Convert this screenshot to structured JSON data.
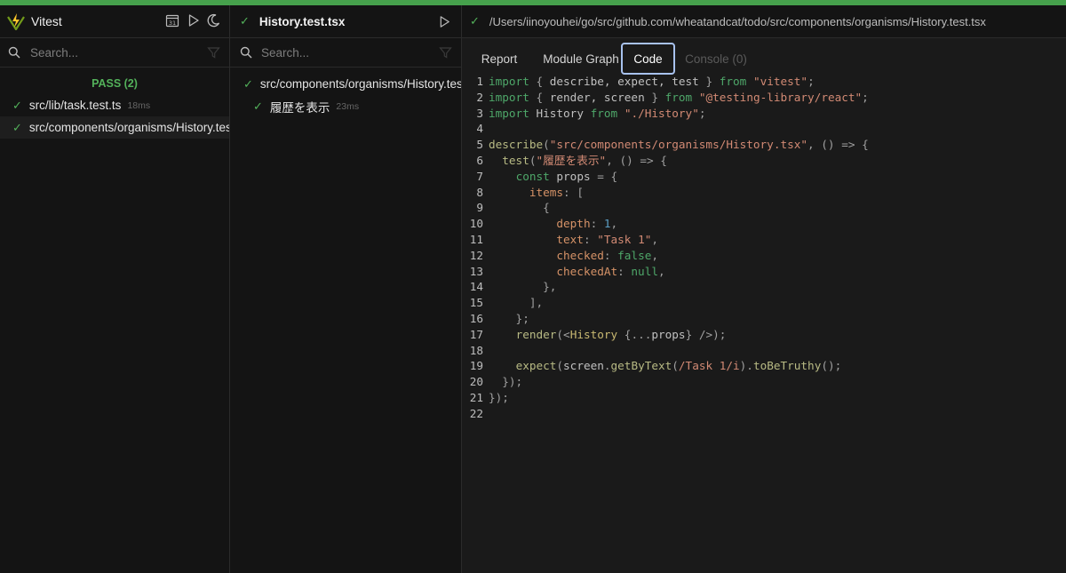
{
  "app": {
    "title": "Vitest"
  },
  "left": {
    "search_placeholder": "Search...",
    "pass_label": "PASS (2)",
    "files": [
      {
        "name": "src/lib/task.test.ts",
        "duration": "18ms"
      },
      {
        "name": "src/components/organisms/History.test.tsx",
        "duration": ""
      }
    ]
  },
  "middle": {
    "title": "History.test.tsx",
    "search_placeholder": "Search...",
    "suite": "src/components/organisms/History.test.tsx",
    "tests": [
      {
        "name": "履歴を表示",
        "duration": "23ms"
      }
    ]
  },
  "right": {
    "path": "/Users/iinoyouhei/go/src/github.com/wheatandcat/todo/src/components/organisms/History.test.tsx",
    "tabs": [
      {
        "label": "Report",
        "state": "normal"
      },
      {
        "label": "Module Graph",
        "state": "normal"
      },
      {
        "label": "Code",
        "state": "active"
      },
      {
        "label": "Console (0)",
        "state": "disabled"
      }
    ]
  },
  "code": {
    "language": "tsx",
    "lines": [
      [
        [
          "kw",
          "import"
        ],
        [
          "punc",
          " { "
        ],
        [
          "id",
          "describe, expect, test"
        ],
        [
          "punc",
          " } "
        ],
        [
          "kw",
          "from"
        ],
        [
          "punc",
          " "
        ],
        [
          "str",
          "\"vitest\""
        ],
        [
          "punc",
          ";"
        ]
      ],
      [
        [
          "kw",
          "import"
        ],
        [
          "punc",
          " { "
        ],
        [
          "id",
          "render, screen"
        ],
        [
          "punc",
          " } "
        ],
        [
          "kw",
          "from"
        ],
        [
          "punc",
          " "
        ],
        [
          "str",
          "\"@testing-library/react\""
        ],
        [
          "punc",
          ";"
        ]
      ],
      [
        [
          "kw",
          "import"
        ],
        [
          "punc",
          " "
        ],
        [
          "id",
          "History"
        ],
        [
          "punc",
          " "
        ],
        [
          "kw",
          "from"
        ],
        [
          "punc",
          " "
        ],
        [
          "str",
          "\"./History\""
        ],
        [
          "punc",
          ";"
        ]
      ],
      [],
      [
        [
          "fn",
          "describe"
        ],
        [
          "punc",
          "("
        ],
        [
          "str",
          "\"src/components/organisms/History.tsx\""
        ],
        [
          "punc",
          ", () => {"
        ]
      ],
      [
        [
          "punc",
          "  "
        ],
        [
          "fn",
          "test"
        ],
        [
          "punc",
          "("
        ],
        [
          "str",
          "\"履歴を表示\""
        ],
        [
          "punc",
          ", () => {"
        ]
      ],
      [
        [
          "punc",
          "    "
        ],
        [
          "kw",
          "const"
        ],
        [
          "punc",
          " "
        ],
        [
          "id",
          "props"
        ],
        [
          "punc",
          " = {"
        ]
      ],
      [
        [
          "punc",
          "      "
        ],
        [
          "prop",
          "items"
        ],
        [
          "punc",
          ": ["
        ]
      ],
      [
        [
          "punc",
          "        {"
        ]
      ],
      [
        [
          "punc",
          "          "
        ],
        [
          "prop",
          "depth"
        ],
        [
          "punc",
          ": "
        ],
        [
          "num",
          "1"
        ],
        [
          "punc",
          ","
        ]
      ],
      [
        [
          "punc",
          "          "
        ],
        [
          "prop",
          "text"
        ],
        [
          "punc",
          ": "
        ],
        [
          "str",
          "\"Task 1\""
        ],
        [
          "punc",
          ","
        ]
      ],
      [
        [
          "punc",
          "          "
        ],
        [
          "prop",
          "checked"
        ],
        [
          "punc",
          ": "
        ],
        [
          "kw",
          "false"
        ],
        [
          "punc",
          ","
        ]
      ],
      [
        [
          "punc",
          "          "
        ],
        [
          "prop",
          "checkedAt"
        ],
        [
          "punc",
          ": "
        ],
        [
          "kw",
          "null"
        ],
        [
          "punc",
          ","
        ]
      ],
      [
        [
          "punc",
          "        },"
        ]
      ],
      [
        [
          "punc",
          "      ],"
        ]
      ],
      [
        [
          "punc",
          "    };"
        ]
      ],
      [
        [
          "punc",
          "    "
        ],
        [
          "fn",
          "render"
        ],
        [
          "punc",
          "(<"
        ],
        [
          "tag",
          "History"
        ],
        [
          "punc",
          " {..."
        ],
        [
          "id",
          "props"
        ],
        [
          "punc",
          "} />);"
        ]
      ],
      [],
      [
        [
          "punc",
          "    "
        ],
        [
          "fn",
          "expect"
        ],
        [
          "punc",
          "("
        ],
        [
          "id",
          "screen"
        ],
        [
          "punc",
          "."
        ],
        [
          "fn",
          "getByText"
        ],
        [
          "punc",
          "("
        ],
        [
          "str",
          "/Task 1/i"
        ],
        [
          "punc",
          ")."
        ],
        [
          "fn",
          "toBeTruthy"
        ],
        [
          "punc",
          "();"
        ]
      ],
      [
        [
          "punc",
          "  });"
        ]
      ],
      [
        [
          "punc",
          "});"
        ]
      ],
      []
    ]
  },
  "colors": {
    "accent_green": "#53b15a",
    "active_tab_border": "#a8c2ee",
    "top_bar": "#46a14c"
  }
}
